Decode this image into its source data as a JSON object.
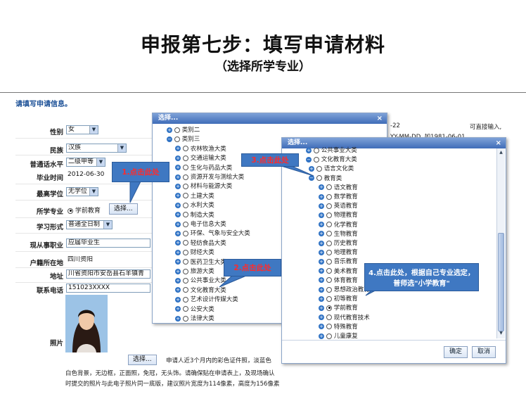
{
  "slide": {
    "title": "申报第七步：填写申请材料",
    "subtitle": "（选择所学专业）"
  },
  "form": {
    "heading": "请填写申请信息。",
    "fields": {
      "gender": {
        "label": "性别",
        "value": "女"
      },
      "ethnicity": {
        "label": "民族",
        "value": "汉族"
      },
      "mandarin": {
        "label": "普通话水平",
        "value": "二级甲等"
      },
      "grad_time": {
        "label": "毕业时间",
        "value": "2012-06-30"
      },
      "degree": {
        "label": "最高学位",
        "value": "无学位"
      },
      "major": {
        "label": "所学专业",
        "value": "学前教育",
        "button": "选择..."
      },
      "study_form": {
        "label": "学习形式",
        "value": "普通全日制"
      },
      "occupation": {
        "label": "现从事职业",
        "value": "应届毕业生"
      },
      "hukou": {
        "label": "户籍所在地",
        "value": "四川资阳"
      },
      "address": {
        "label": "地址",
        "value": "川省资阳市安岳县石羊镇青"
      },
      "phone": {
        "label": "联系电话",
        "value": "151023XXXX"
      },
      "photo": {
        "label": "照片",
        "button": "选择..."
      }
    },
    "right_hints": {
      "a": "-22",
      "b": "可直接输入,",
      "c": "YY-MM-DD, 如1981-06-01"
    },
    "photo_note": [
      "申请人近3个月内的彩色证件照，淡蓝色",
      "白色背景，无边框，正面照，免冠，无头饰。请确保贴在申请表上，及现场确认",
      "时提交的照片与此电子照片同一底版，建议照片宽度为114像素，高度为156像素"
    ]
  },
  "dialog1": {
    "title": "选择...",
    "close": "×",
    "items": [
      "类别二",
      "类别三",
      "农林牧渔大类",
      "交通运输大类",
      "生化与药品大类",
      "资源开发与测绘大类",
      "材料与能源大类",
      "土建大类",
      "水利大类",
      "制造大类",
      "电子信息大类",
      "环保、气象与安全大类",
      "轻纺食品大类",
      "财经大类",
      "医药卫生大类",
      "旅游大类",
      "公共事业大类",
      "文化教育大类",
      "艺术设计传媒大类",
      "公安大类",
      "法律大类"
    ]
  },
  "dialog2": {
    "title": "选择...",
    "close": "×",
    "items": [
      "公共事业大类",
      "文化教育大类",
      "语言文化类",
      "教育类",
      "语文教育",
      "数学教育",
      "英语教育",
      "物理教育",
      "化学教育",
      "生物教育",
      "历史教育",
      "地理教育",
      "音乐教育",
      "美术教育",
      "体育教育",
      "思想政治教育",
      "初等教育",
      "学前教育",
      "现代教育技术",
      "特殊教育",
      "儿童康复"
    ],
    "ok": "确定",
    "cancel": "取消"
  },
  "callouts": {
    "c1": "1.点击此处",
    "c2": "2.点击此处",
    "c3": "3.点击此处",
    "c4": "4.点击此处，根据自己专业选定，普师选\"小学教育\""
  }
}
